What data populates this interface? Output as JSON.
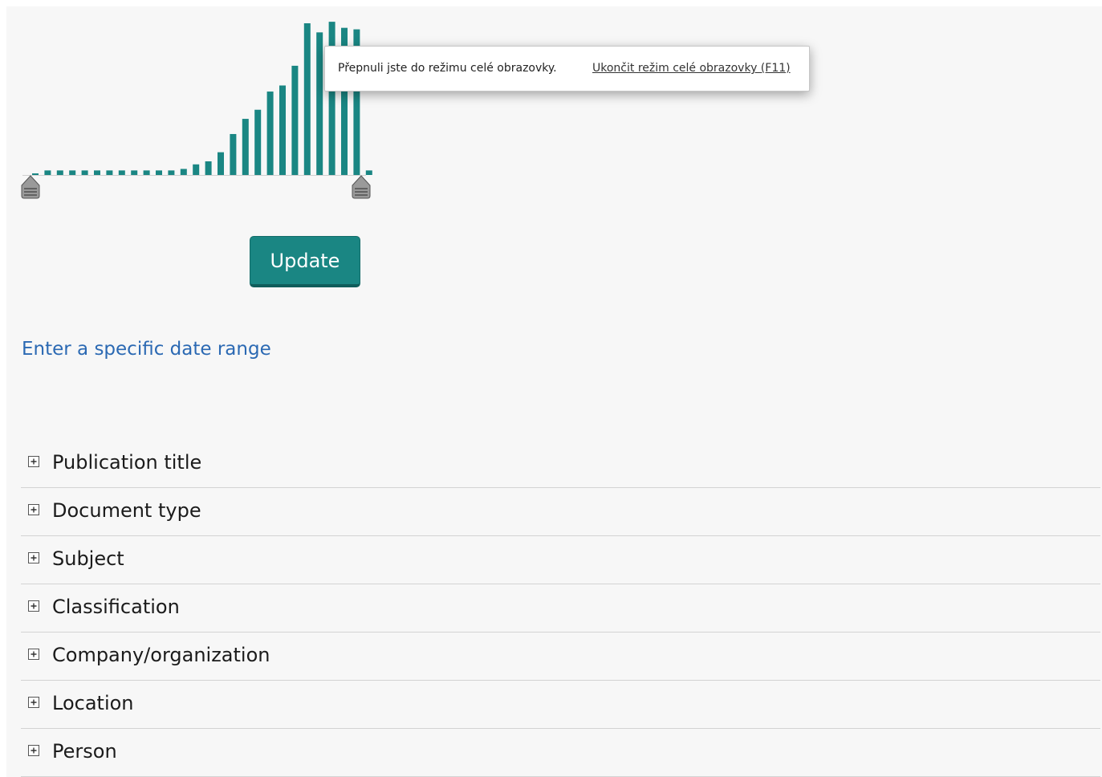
{
  "colors": {
    "accent": "#1a8683",
    "link": "#2b69b3",
    "panel_background": "#f7f7f7",
    "divider": "#d3d3d3"
  },
  "date_histogram": {
    "bar_color": "#1a8683",
    "bars": [
      0.01,
      0.03,
      0.03,
      0.03,
      0.03,
      0.03,
      0.03,
      0.03,
      0.03,
      0.03,
      0.03,
      0.03,
      0.04,
      0.07,
      0.09,
      0.15,
      0.27,
      0.37,
      0.43,
      0.55,
      0.59,
      0.72,
      1.0,
      0.94,
      1.01,
      0.97,
      0.96,
      0.03
    ],
    "range_start_handle_icon": "slider-handle-icon",
    "range_end_handle_icon": "slider-handle-icon"
  },
  "update_button": {
    "label": "Update"
  },
  "date_range_link": {
    "label": "Enter a specific date range"
  },
  "facets": [
    {
      "label": "Publication title",
      "icon": "expand-plus-icon"
    },
    {
      "label": "Document type",
      "icon": "expand-plus-icon"
    },
    {
      "label": "Subject",
      "icon": "expand-plus-icon"
    },
    {
      "label": "Classification",
      "icon": "expand-plus-icon"
    },
    {
      "label": "Company/organization",
      "icon": "expand-plus-icon"
    },
    {
      "label": "Location",
      "icon": "expand-plus-icon"
    },
    {
      "label": "Person",
      "icon": "expand-plus-icon"
    }
  ],
  "fullscreen_notice": {
    "message": "Přepnuli jste do režimu celé obrazovky.",
    "exit_link": "Ukončit režim celé obrazovky (F11)"
  }
}
